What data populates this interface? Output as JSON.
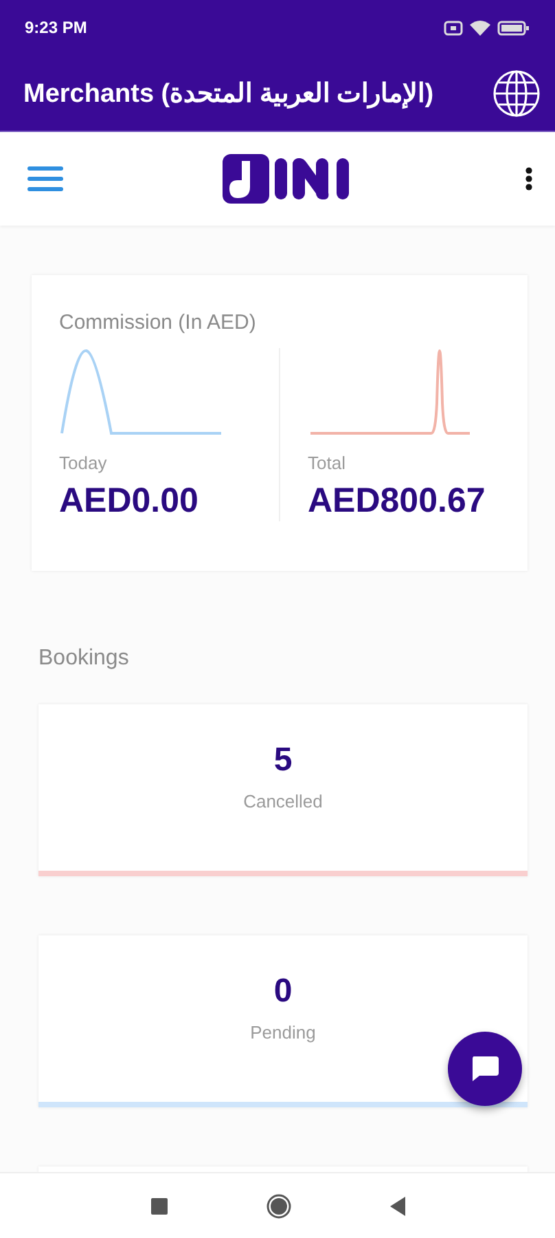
{
  "status_bar": {
    "time": "9:23 PM"
  },
  "app_bar": {
    "title": "Merchants (الإمارات العربية المتحدة)"
  },
  "commission": {
    "title": "Commission (In AED)",
    "stats": [
      {
        "label": "Today",
        "value": "AED0.00",
        "color": "#a9d2f5",
        "kind": "early_peak"
      },
      {
        "label": "Total",
        "value": "AED800.67",
        "color": "#f2b3a8",
        "kind": "late_spike"
      }
    ]
  },
  "bookings": {
    "title": "Bookings",
    "cards": [
      {
        "count": "5",
        "label": "Cancelled",
        "color": "#f9cfcf"
      },
      {
        "count": "0",
        "label": "Pending",
        "color": "#cfe5fb"
      }
    ]
  }
}
